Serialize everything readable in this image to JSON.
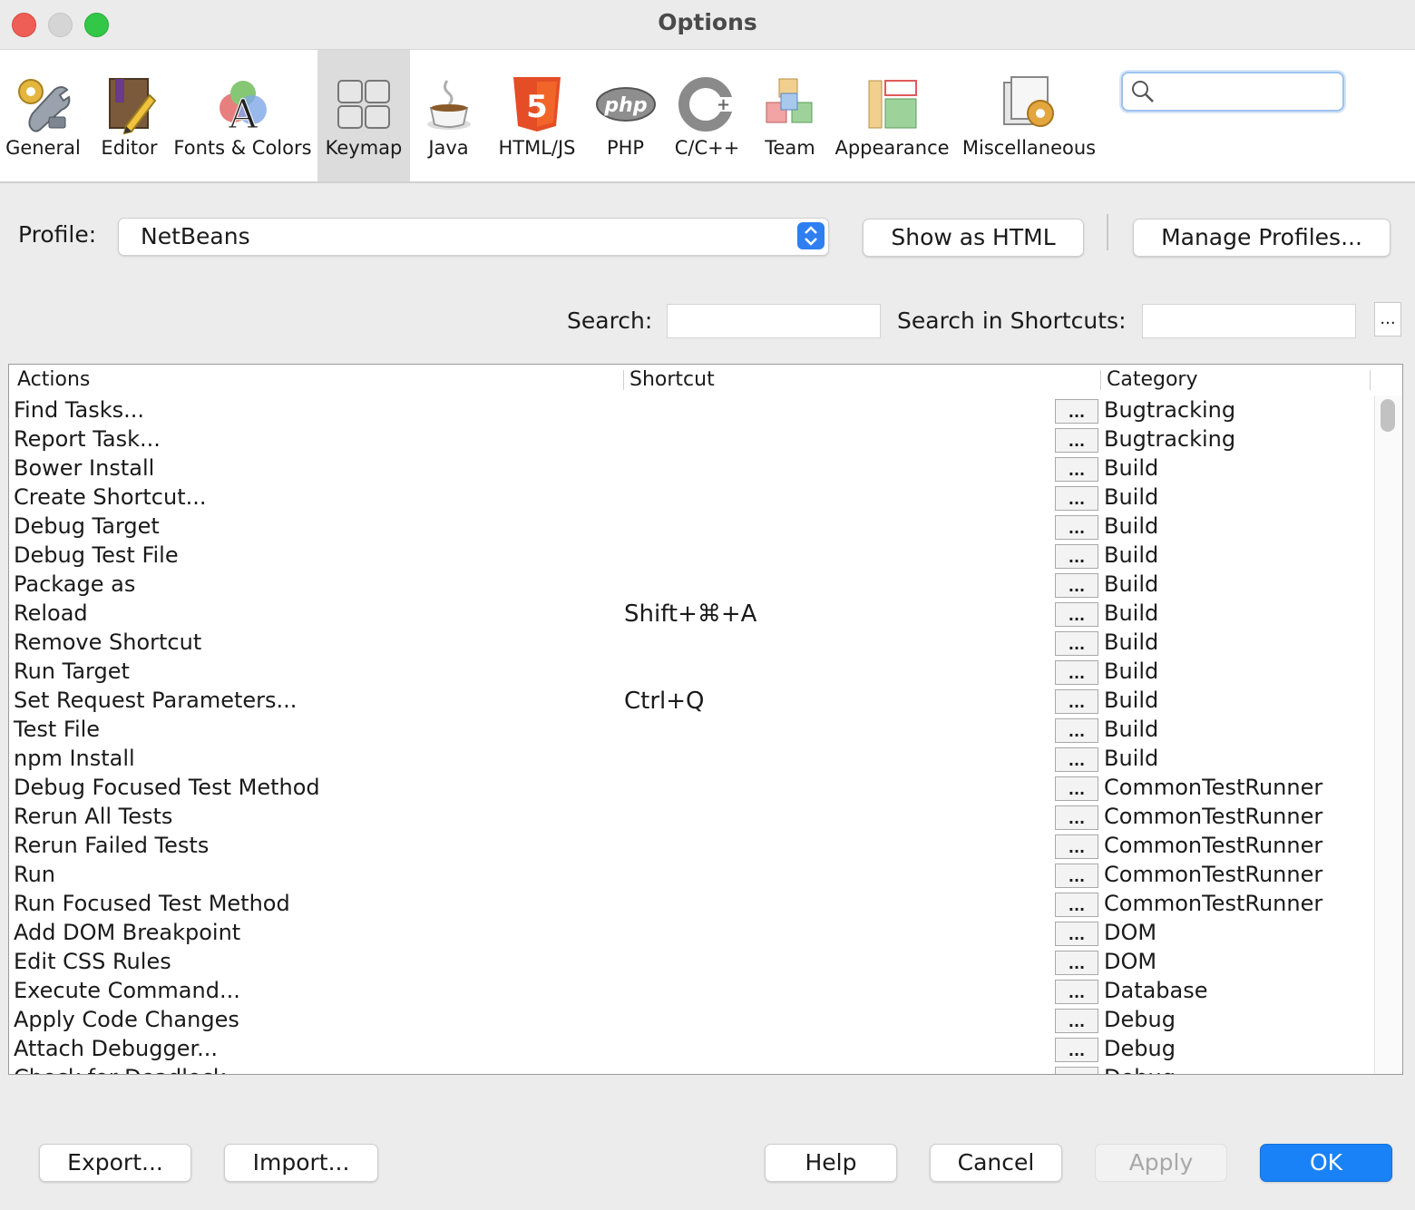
{
  "window": {
    "title": "Options"
  },
  "toolbar": {
    "items": [
      {
        "label": "General",
        "icon": "general-settings-icon"
      },
      {
        "label": "Editor",
        "icon": "editor-icon"
      },
      {
        "label": "Fonts & Colors",
        "icon": "fonts-colors-icon"
      },
      {
        "label": "Keymap",
        "icon": "keymap-icon",
        "selected": true
      },
      {
        "label": "Java",
        "icon": "java-icon"
      },
      {
        "label": "HTML/JS",
        "icon": "html5-icon"
      },
      {
        "label": "PHP",
        "icon": "php-icon"
      },
      {
        "label": "C/C++",
        "icon": "cpp-icon"
      },
      {
        "label": "Team",
        "icon": "team-icon"
      },
      {
        "label": "Appearance",
        "icon": "appearance-icon"
      },
      {
        "label": "Miscellaneous",
        "icon": "miscellaneous-icon"
      }
    ],
    "search_value": ""
  },
  "profile": {
    "label": "Profile:",
    "selected": "NetBeans",
    "show_html_label": "Show as HTML",
    "manage_label": "Manage Profiles..."
  },
  "search": {
    "label": "Search:",
    "value": "",
    "shortcuts_label": "Search in Shortcuts:",
    "shortcuts_value": "",
    "more_label": "..."
  },
  "table": {
    "columns": [
      "Actions",
      "Shortcut",
      "Category"
    ],
    "ellipsis": "...",
    "rows": [
      {
        "action": "Find Tasks...",
        "shortcut": "",
        "category": "Bugtracking"
      },
      {
        "action": "Report Task...",
        "shortcut": "",
        "category": "Bugtracking"
      },
      {
        "action": "Bower Install",
        "shortcut": "",
        "category": "Build"
      },
      {
        "action": "Create Shortcut...",
        "shortcut": "",
        "category": "Build"
      },
      {
        "action": "Debug Target",
        "shortcut": "",
        "category": "Build"
      },
      {
        "action": "Debug Test File",
        "shortcut": "",
        "category": "Build"
      },
      {
        "action": "Package as",
        "shortcut": "",
        "category": "Build"
      },
      {
        "action": "Reload",
        "shortcut": "Shift+⌘+A",
        "category": "Build"
      },
      {
        "action": "Remove Shortcut",
        "shortcut": "",
        "category": "Build"
      },
      {
        "action": "Run Target",
        "shortcut": "",
        "category": "Build"
      },
      {
        "action": "Set Request Parameters...",
        "shortcut": "Ctrl+Q",
        "category": "Build"
      },
      {
        "action": "Test File",
        "shortcut": "",
        "category": "Build"
      },
      {
        "action": "npm Install",
        "shortcut": "",
        "category": "Build"
      },
      {
        "action": "Debug Focused Test Method",
        "shortcut": "",
        "category": "CommonTestRunner"
      },
      {
        "action": "Rerun All Tests",
        "shortcut": "",
        "category": "CommonTestRunner"
      },
      {
        "action": "Rerun Failed Tests",
        "shortcut": "",
        "category": "CommonTestRunner"
      },
      {
        "action": "Run",
        "shortcut": "",
        "category": "CommonTestRunner"
      },
      {
        "action": "Run Focused Test Method",
        "shortcut": "",
        "category": "CommonTestRunner"
      },
      {
        "action": "Add DOM Breakpoint",
        "shortcut": "",
        "category": "DOM"
      },
      {
        "action": "Edit CSS Rules",
        "shortcut": "",
        "category": "DOM"
      },
      {
        "action": "Execute Command...",
        "shortcut": "",
        "category": "Database"
      },
      {
        "action": "Apply Code Changes",
        "shortcut": "",
        "category": "Debug"
      },
      {
        "action": "Attach Debugger...",
        "shortcut": "",
        "category": "Debug"
      },
      {
        "action": "Check for Deadlock",
        "shortcut": "",
        "category": "Debug"
      }
    ]
  },
  "buttons": {
    "export": "Export...",
    "import": "Import...",
    "help": "Help",
    "cancel": "Cancel",
    "apply": "Apply",
    "ok": "OK"
  },
  "colors": {
    "accent": "#1a82f7",
    "selected_tab": "#dcdcdc",
    "close": "#ee5e57",
    "maximize": "#33c748"
  }
}
